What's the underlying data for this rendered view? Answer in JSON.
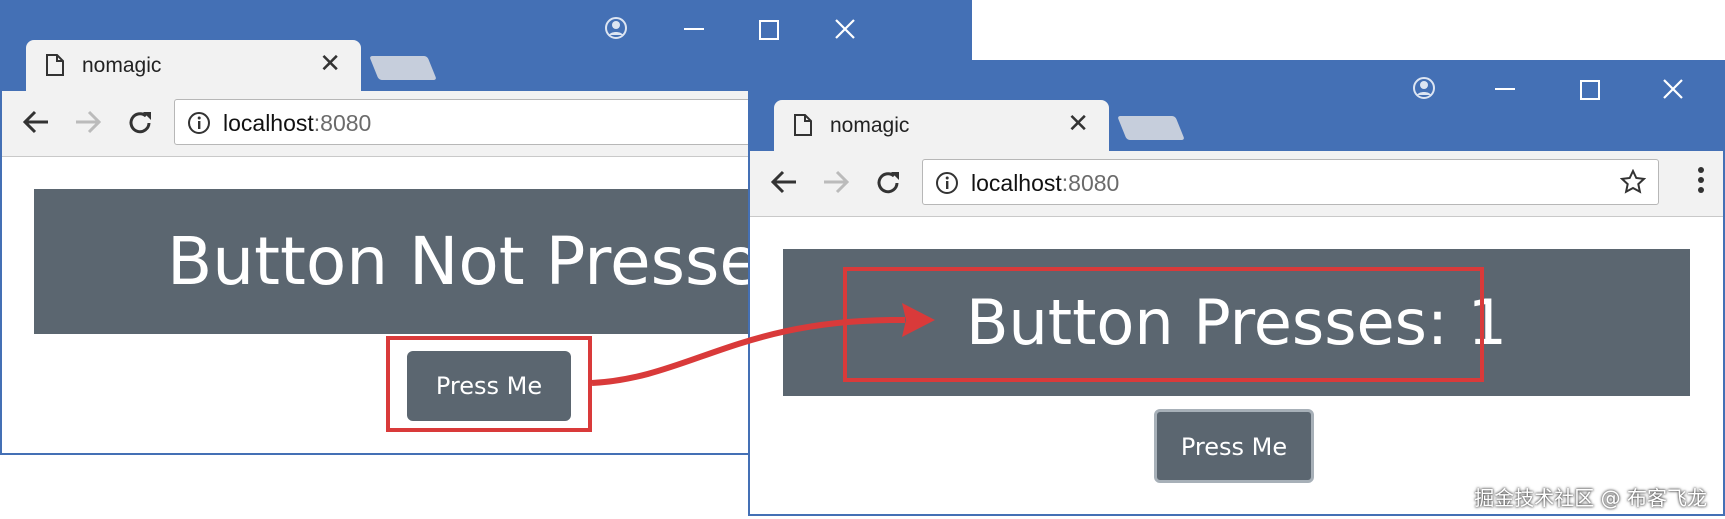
{
  "colors": {
    "chrome": "#4470b5",
    "banner": "#5b6670",
    "highlight": "#d93a3a"
  },
  "window_left": {
    "tab_title": "nomagic",
    "address": {
      "host": "localhost",
      "port": ":8080"
    },
    "banner_text": "Button Not Pressed",
    "button_label": "Press Me"
  },
  "window_right": {
    "tab_title": "nomagic",
    "address": {
      "host": "localhost",
      "port": ":8080"
    },
    "banner_text": "Button Presses: 1",
    "button_label": "Press Me"
  },
  "icons": [
    "document-icon",
    "close-icon",
    "new-tab-icon",
    "profile-icon",
    "minimize-icon",
    "maximize-icon",
    "window-close-icon",
    "back-icon",
    "forward-icon",
    "reload-icon",
    "info-icon",
    "star-icon",
    "menu-icon"
  ],
  "watermark": "掘金技术社区 @ 布客飞龙"
}
